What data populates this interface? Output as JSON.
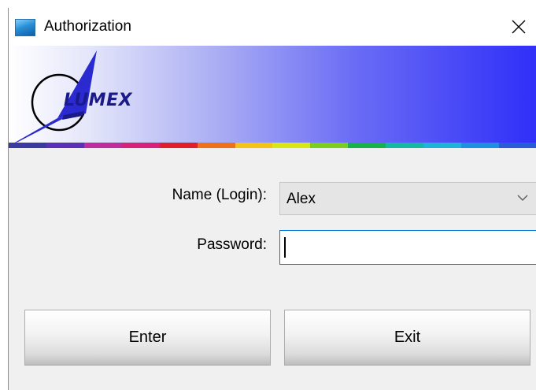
{
  "window": {
    "title": "Authorization",
    "app_icon": "app-icon",
    "close_icon": "close-icon"
  },
  "banner": {
    "logo_text": "LUMEX",
    "colors": {
      "logo_blue": "#1a1a8a",
      "gradient_end": "#2f2ff8"
    },
    "rainbow": [
      "#3a3aa0",
      "#5b2fb8",
      "#c02c9e",
      "#d8217a",
      "#e11f2a",
      "#f07218",
      "#f3c415",
      "#d8e612",
      "#7ccd1e",
      "#19b24a",
      "#14b8a3",
      "#1fb3d9",
      "#1e8fe3",
      "#2a5bd9"
    ]
  },
  "form": {
    "name_label": "Name (Login):",
    "name_value": "Alex",
    "password_label": "Password:",
    "password_value": ""
  },
  "buttons": {
    "enter": "Enter",
    "exit": "Exit"
  }
}
